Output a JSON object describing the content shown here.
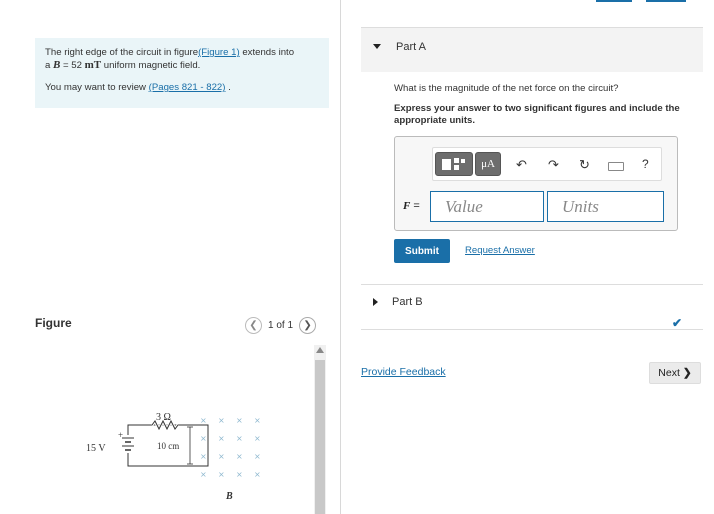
{
  "problem": {
    "intro_before_link": "The right edge of the circuit in figure",
    "figure_link": "(Figure 1)",
    "intro_after_link": " extends into",
    "line2_prefix": "a ",
    "b_symbol": "B",
    "line2_equals": " = 52 ",
    "b_unit": "mT",
    "line2_suffix": " uniform magnetic field.",
    "review_prefix": "You may want to review ",
    "review_link": "(Pages 821 - 822)",
    "review_suffix": " ."
  },
  "figure": {
    "title": "Figure",
    "pager_text": "1 of 1",
    "prev_icon": "chevron-left-icon",
    "next_icon": "chevron-right-icon",
    "resistor_label": "3 Ω",
    "voltage_label": "15 V",
    "plus_sign": "+",
    "length_label": "10 cm",
    "field_label": "B",
    "field_marker": "×"
  },
  "partA": {
    "title": "Part A",
    "question": "What is the magnitude of the net force on the circuit?",
    "instruction": "Express your answer to two significant figures and include the appropriate units.",
    "toolbar_mu": "μA",
    "undo_icon": "undo-icon",
    "redo_icon": "redo-icon",
    "reset_icon": "reset-icon",
    "keyboard_icon": "keyboard-icon",
    "help_label": "?",
    "variable": "F",
    "equals": " =",
    "value_placeholder": "Value",
    "units_placeholder": "Units",
    "submit_label": "Submit",
    "request_answer_label": "Request Answer"
  },
  "partB": {
    "title": "Part B",
    "status_icon": "check-icon"
  },
  "footer": {
    "feedback_label": "Provide Feedback",
    "next_label": "Next",
    "next_icon": "chevron-right-icon"
  },
  "colors": {
    "accent": "#1a6fa8",
    "info_bg": "#eaf5f8",
    "header_bg": "#f3f3f3"
  }
}
